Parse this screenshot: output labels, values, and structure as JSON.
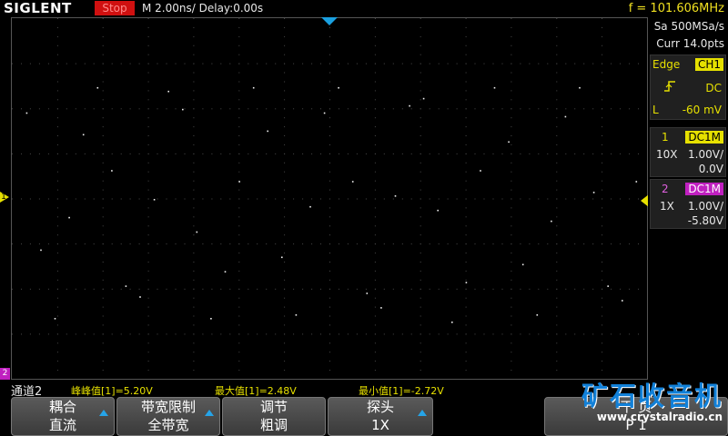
{
  "header": {
    "brand": "SIGLENT",
    "run_state": "Stop",
    "timebase": "M 2.00ns/",
    "delay": "Delay:0.00s",
    "frequency": "f = 101.606MHz"
  },
  "right_panel": {
    "sample_rate": "Sa 500MSa/s",
    "record_length": "Curr 14.0pts",
    "trigger": {
      "type": "Edge",
      "source": "CH1",
      "coupling": "DC",
      "level_label": "L",
      "level": "-60 mV"
    },
    "ch1": {
      "number": "1",
      "coupling": "DC1M",
      "probe": "10X",
      "scale": "1.00V/",
      "offset": "0.0V"
    },
    "ch2": {
      "number": "2",
      "coupling": "DC1M",
      "probe": "1X",
      "scale": "1.00V/",
      "offset": "-5.80V"
    }
  },
  "markers": {
    "ch1": "1",
    "ch2": "2"
  },
  "measurements": {
    "title": "通道2",
    "items": [
      "峰峰值[1]=5.20V",
      "最大值[1]=2.48V",
      "最小值[1]=-2.72V"
    ]
  },
  "menu": {
    "keys": [
      {
        "line1": "耦合",
        "line2": "直流"
      },
      {
        "line1": "带宽限制",
        "line2": "全带宽"
      },
      {
        "line1": "调节",
        "line2": "粗调"
      },
      {
        "line1": "探头",
        "line2": "1X"
      },
      {
        "line1": "下 页",
        "line2": "P 1"
      }
    ]
  },
  "watermark": {
    "title": "矿石收音机",
    "url": "www.crystalradio.cn"
  },
  "colors": {
    "ch1": "#e6e000",
    "ch2": "#c020c0",
    "trigger_marker": "#1aa0e0",
    "stop": "#d01010"
  },
  "trace_points": [
    [
      0.625,
      1.92
    ],
    [
      1.25,
      -1.12
    ],
    [
      1.875,
      -2.64
    ],
    [
      2.5,
      -0.4
    ],
    [
      3.125,
      1.44
    ],
    [
      3.75,
      2.48
    ],
    [
      4.375,
      0.64
    ],
    [
      5.0,
      -1.92
    ],
    [
      5.625,
      -2.16
    ],
    [
      6.25,
      0.0
    ],
    [
      6.875,
      2.4
    ],
    [
      7.5,
      2.0
    ],
    [
      8.125,
      -0.72
    ],
    [
      8.75,
      -2.64
    ],
    [
      9.375,
      -1.6
    ],
    [
      10.0,
      0.4
    ],
    [
      10.625,
      2.48
    ],
    [
      11.25,
      1.52
    ],
    [
      11.875,
      -1.28
    ],
    [
      12.5,
      -2.56
    ],
    [
      13.125,
      -0.16
    ],
    [
      13.75,
      1.92
    ],
    [
      14.375,
      2.48
    ],
    [
      15.0,
      0.4
    ],
    [
      15.625,
      -2.08
    ],
    [
      16.25,
      -2.4
    ],
    [
      16.875,
      0.08
    ],
    [
      17.5,
      2.08
    ],
    [
      18.125,
      2.24
    ],
    [
      18.75,
      -0.24
    ],
    [
      19.375,
      -2.72
    ],
    [
      20.0,
      -1.84
    ],
    [
      20.625,
      0.64
    ],
    [
      21.25,
      2.48
    ],
    [
      21.875,
      1.28
    ],
    [
      22.5,
      -1.44
    ],
    [
      23.125,
      -2.56
    ],
    [
      23.75,
      -0.48
    ],
    [
      24.375,
      1.84
    ],
    [
      25.0,
      2.48
    ],
    [
      25.625,
      0.16
    ],
    [
      26.25,
      -1.92
    ],
    [
      26.875,
      -2.24
    ],
    [
      27.5,
      0.4
    ],
    [
      28.125,
      2.32
    ]
  ]
}
